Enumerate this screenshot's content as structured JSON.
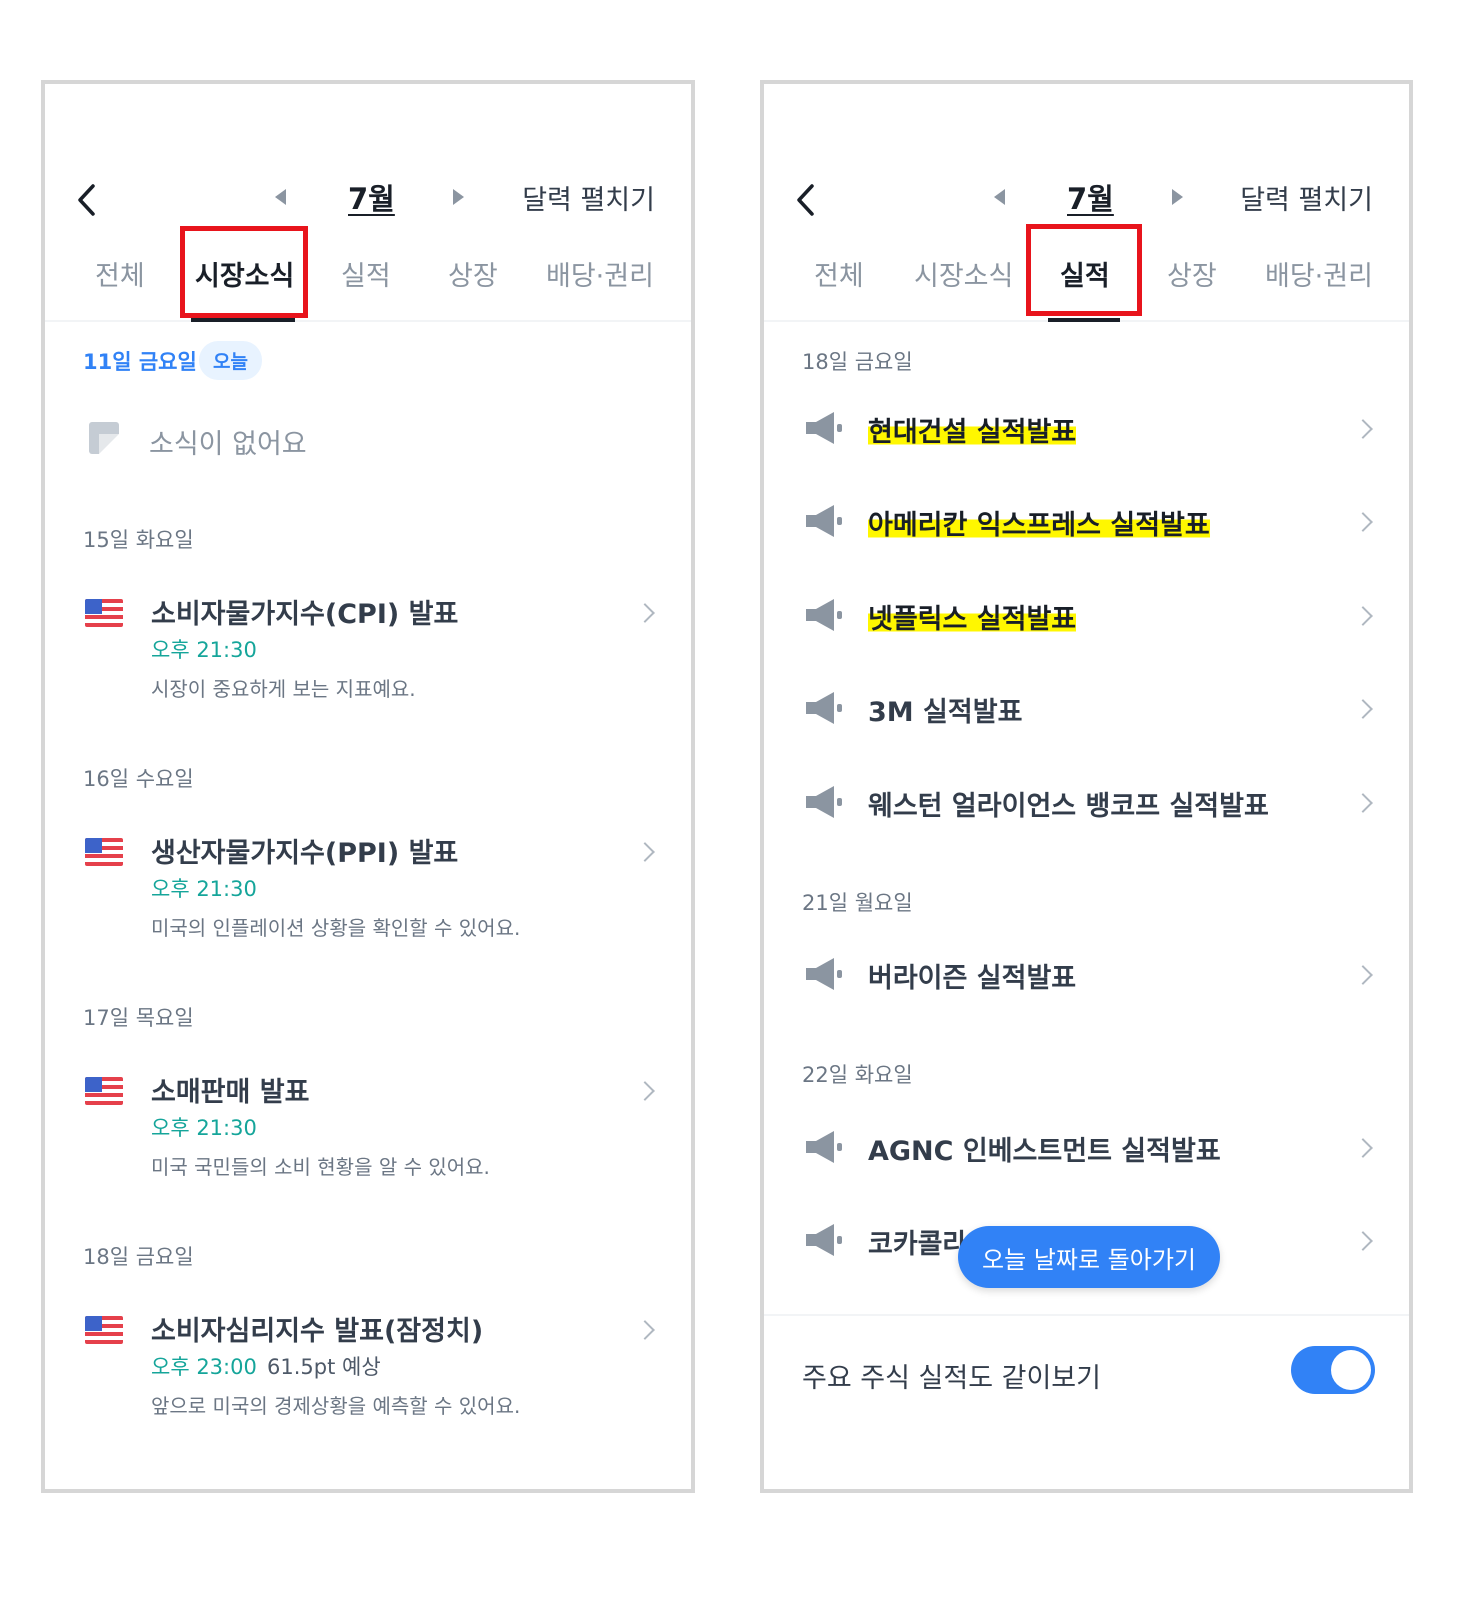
{
  "left": {
    "month": "7월",
    "expand_label": "달력 펼치기",
    "tabs": [
      "전체",
      "시장소식",
      "실적",
      "상장",
      "배당·권리"
    ],
    "active_tab": "시장소식",
    "today": {
      "date": "11일 금요일",
      "badge": "오늘",
      "empty": "소식이 없어요"
    },
    "groups": [
      {
        "date": "15일 화요일",
        "title": "소비자물가지수(CPI) 발표",
        "time": "오후 21:30",
        "forecast": "",
        "desc": "시장이 중요하게 보는 지표예요."
      },
      {
        "date": "16일 수요일",
        "title": "생산자물가지수(PPI) 발표",
        "time": "오후 21:30",
        "forecast": "",
        "desc": "미국의 인플레이션 상황을 확인할 수 있어요."
      },
      {
        "date": "17일 목요일",
        "title": "소매판매 발표",
        "time": "오후 21:30",
        "forecast": "",
        "desc": "미국 국민들의 소비 현황을 알 수 있어요."
      },
      {
        "date": "18일 금요일",
        "title": "소비자심리지수 발표(잠정치)",
        "time": "오후 23:00",
        "forecast": "61.5pt 예상",
        "desc": "앞으로 미국의 경제상황을 예측할 수 있어요."
      }
    ]
  },
  "right": {
    "month": "7월",
    "expand_label": "달력 펼치기",
    "tabs": [
      "전체",
      "시장소식",
      "실적",
      "상장",
      "배당·권리"
    ],
    "active_tab": "실적",
    "groups": [
      {
        "date": "18일 금요일",
        "items": [
          "현대건설 실적발표",
          "아메리칸 익스프레스 실적발표",
          "넷플릭스 실적발표",
          "3M 실적발표",
          "웨스턴 얼라이언스 뱅코프 실적발표"
        ]
      },
      {
        "date": "21일 월요일",
        "items": [
          "버라이즌 실적발표"
        ]
      },
      {
        "date": "22일 화요일",
        "items": [
          "AGNC 인베스트먼트 실적발표",
          "코카콜라"
        ]
      }
    ],
    "highlighted_items": [
      "현대건설 실적발표",
      "아메리칸 익스프레스 실적발표",
      "넷플릭스 실적발표"
    ],
    "floating_button": "오늘 날짜로 돌아가기",
    "footer_label": "주요 주식 실적도 같이보기",
    "toggle_on": true
  },
  "colors": {
    "accent_blue": "#3182f6",
    "time_teal": "#15a59a",
    "annotation_red": "#e8141c",
    "highlight_yellow": "#fff700"
  },
  "icons": [
    "back-arrow-icon",
    "prev-month-icon",
    "next-month-icon",
    "memo-icon",
    "us-flag-icon",
    "megaphone-icon",
    "chevron-right-icon"
  ]
}
